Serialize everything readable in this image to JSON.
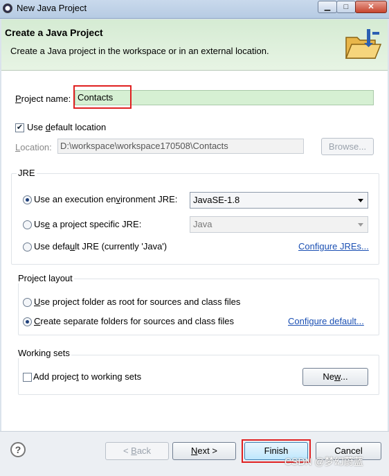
{
  "window": {
    "title": "New Java Project",
    "min_label": "▁",
    "max_label": "□",
    "close_label": "✕"
  },
  "header": {
    "title": "Create a Java Project",
    "description": "Create a Java project in the workspace or in an external location.",
    "icon": "new-project-folder-icon"
  },
  "project": {
    "name_label_pre": "P",
    "name_label_post": "roject name:",
    "name_value": "Contacts",
    "use_default_pre": "Use ",
    "use_default_u": "d",
    "use_default_post": "efault location",
    "use_default_checked": true,
    "location_label_pre": "L",
    "location_label_post": "ocation:",
    "location_value": "D:\\workspace\\workspace170508\\Contacts",
    "browse_label": "Browse..."
  },
  "jre": {
    "group_title": "JRE",
    "option1_pre": "Use an execution en",
    "option1_u": "v",
    "option1_post": "ironment JRE:",
    "option1_value": "JavaSE-1.8",
    "option2_pre": "Us",
    "option2_u": "e",
    "option2_post": " a project specific JRE:",
    "option2_value": "Java",
    "option3_pre": "Use defa",
    "option3_u": "u",
    "option3_post": "lt JRE (currently 'Java')",
    "configure_link": "Configure JREs...",
    "selected": 1
  },
  "layout": {
    "group_title": "Project layout",
    "option1_u": "U",
    "option1_post": "se project folder as root for sources and class files",
    "option2_u": "C",
    "option2_post": "reate separate folders for sources and class files",
    "configure_link": "Configure default...",
    "selected": 2
  },
  "working_sets": {
    "group_title": "Working sets",
    "add_pre": "Add projec",
    "add_u": "t",
    "add_post": " to working sets",
    "add_checked": false,
    "new_pre": "Ne",
    "new_u": "w",
    "new_post": "..."
  },
  "footer": {
    "help_label": "?",
    "back_pre": "< ",
    "back_u": "B",
    "back_post": "ack",
    "next_u": "N",
    "next_post": "ext >",
    "finish_label": "Finish",
    "cancel_label": "Cancel"
  },
  "watermark": "CSDN @梦幻蔚蓝",
  "colors": {
    "header_bg": "#d5ebd3",
    "highlight_red": "#e02020",
    "link": "#1a4fb3"
  }
}
